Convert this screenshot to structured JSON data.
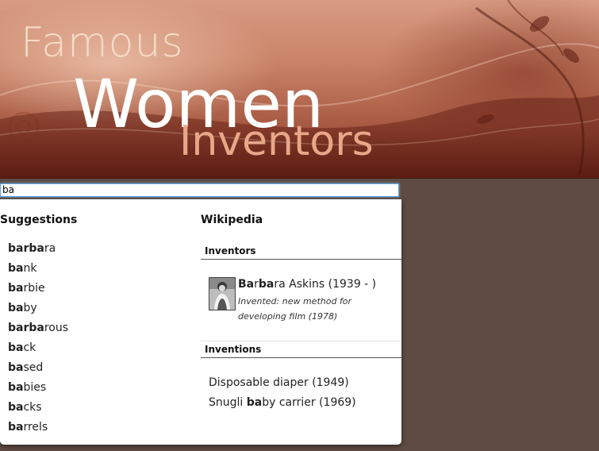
{
  "banner": {
    "line1": "Famous",
    "line2": "Women",
    "line3": "Inventors"
  },
  "search": {
    "value": "ba",
    "placeholder": ""
  },
  "suggestions": {
    "title": "Suggestions",
    "items": [
      {
        "bold1": "bar",
        "plain1": "",
        "bold2": "ba",
        "plain2": "ra"
      },
      {
        "bold1": "ba",
        "plain1": "nk",
        "bold2": "",
        "plain2": ""
      },
      {
        "bold1": "ba",
        "plain1": "rbie",
        "bold2": "",
        "plain2": ""
      },
      {
        "bold1": "ba",
        "plain1": "by",
        "bold2": "",
        "plain2": ""
      },
      {
        "bold1": "bar",
        "plain1": "",
        "bold2": "ba",
        "plain2": "rous"
      },
      {
        "bold1": "ba",
        "plain1": "ck",
        "bold2": "",
        "plain2": ""
      },
      {
        "bold1": "ba",
        "plain1": "sed",
        "bold2": "",
        "plain2": ""
      },
      {
        "bold1": "ba",
        "plain1": "bies",
        "bold2": "",
        "plain2": ""
      },
      {
        "bold1": "ba",
        "plain1": "cks",
        "bold2": "",
        "plain2": ""
      },
      {
        "bold1": "ba",
        "plain1": "rrels",
        "bold2": "",
        "plain2": ""
      }
    ]
  },
  "wikipedia": {
    "title": "Wikipedia",
    "inventors_heading": "Inventors",
    "inventor": {
      "name_bold1": "Ba",
      "name_plain1": "r",
      "name_bold2": "ba",
      "name_plain2": "ra Askins (1939 - )",
      "description": "Invented: new method for developing film (1978)"
    },
    "inventions_heading": "Inventions",
    "inventions": [
      {
        "pre": "Disposable diaper (1949)",
        "bold": "",
        "post": ""
      },
      {
        "pre": "Snugli ",
        "bold": "ba",
        "post": "by carrier (1969)"
      }
    ]
  },
  "colors": {
    "page_background": "#5e4b43",
    "focus_ring": "#5fa2dd"
  }
}
